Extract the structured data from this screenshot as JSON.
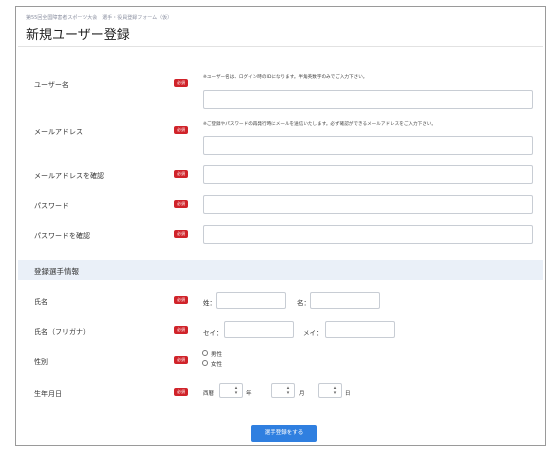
{
  "breadcrumb": "第55回全国障害者スポーツ大会　選手・役員登録フォーム（仮）",
  "page_title": "新規ユーザー登録",
  "required_badge": "必須",
  "account": {
    "username_label": "ユーザー名",
    "username_note": "※ユーザー名は、ログイン時のIDになります。半角英数字のみでご入力下さい。",
    "email_label": "メールアドレス",
    "email_note": "※ご登録やパスワードの再発行時にメールを送信いたします。必ず確認ができるメールアドレスをご入力下さい。",
    "email_confirm_label": "メールアドレスを確認",
    "password_label": "パスワード",
    "password_confirm_label": "パスワードを確認"
  },
  "athlete_section": {
    "title": "登録選手情報",
    "name_label": "氏名",
    "last_name_prefix": "姓：",
    "first_name_prefix": "名：",
    "kana_label": "氏名（フリガナ）",
    "kana_last_prefix": "セイ：",
    "kana_first_prefix": "メイ：",
    "gender_label": "性別",
    "gender_options": [
      "男性",
      "女性"
    ],
    "birthdate_label": "生年月日",
    "era": "西暦",
    "year_unit": "年",
    "month_unit": "月",
    "day_unit": "日"
  },
  "submit_label": "選手登録をする",
  "colors": {
    "required": "#d0232a",
    "section_bg": "#eaf0f8",
    "button": "#2f7fe0"
  }
}
